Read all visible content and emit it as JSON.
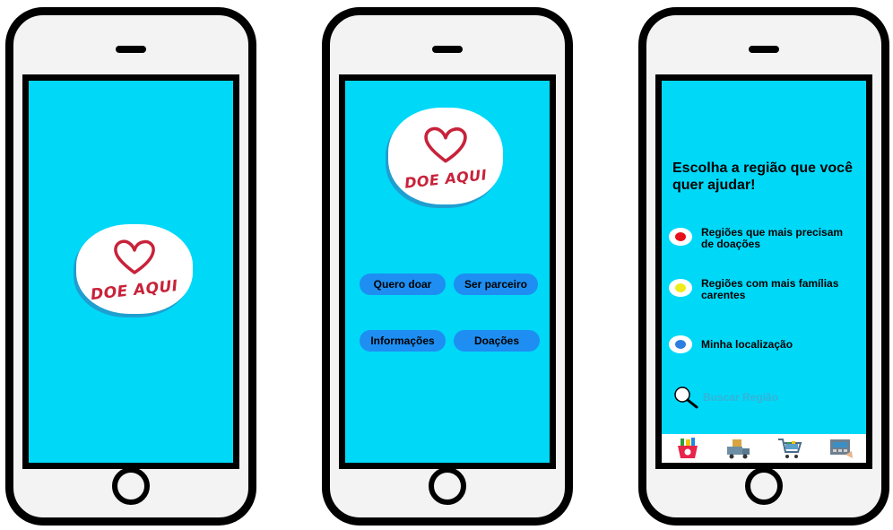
{
  "phone1": {
    "logo_text": "DOE AQUI"
  },
  "phone2": {
    "logo_text": "DOE AQUI",
    "buttons": [
      {
        "label": "Quero doar"
      },
      {
        "label": "Ser parceiro"
      },
      {
        "label": "Informações"
      },
      {
        "label": "Doações"
      }
    ]
  },
  "phone3": {
    "title": "Escolha a região que você quer ajudar!",
    "options": [
      {
        "label": "Regiões que mais precisam de doações",
        "color": "#e8101a"
      },
      {
        "label": "Regiões com mais famílias carentes",
        "color": "#f0ec1c"
      },
      {
        "label": "Minha localização",
        "color": "#2a7fe0"
      }
    ],
    "search": {
      "placeholder": "Buscar Região",
      "icon": "magnifier-icon"
    },
    "nav_icons": [
      "basket-icon",
      "delivery-truck-icon",
      "shopping-cart-icon",
      "register-icon"
    ]
  },
  "colors": {
    "screen": "#00d8f8",
    "button": "#1e8ef2",
    "logo_red": "#c8223a"
  }
}
